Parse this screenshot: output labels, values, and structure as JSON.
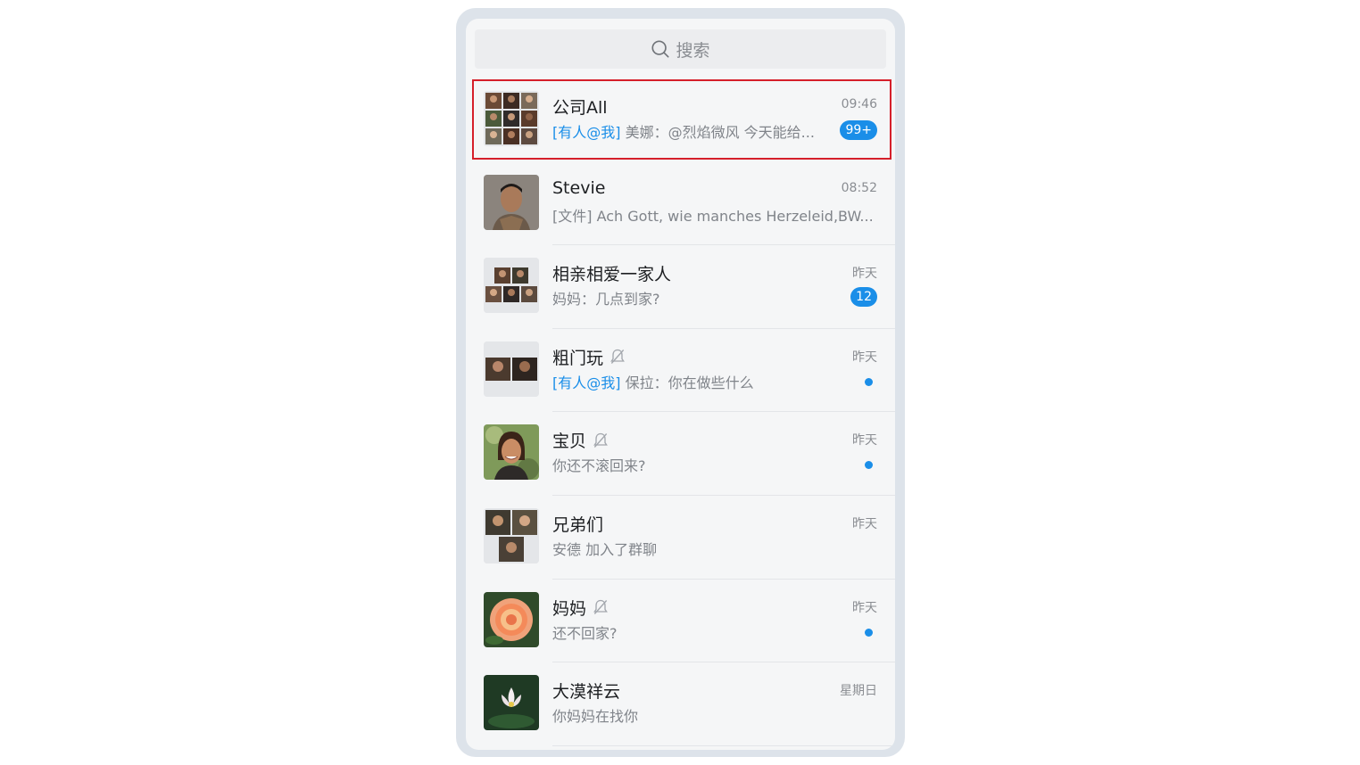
{
  "search": {
    "placeholder_label": "搜索"
  },
  "chats": [
    {
      "name": "公司All",
      "time": "09:46",
      "mention": "[有人@我]",
      "preview": "美娜：@烈焰微风 今天能给...",
      "badge": "99+",
      "muted": false,
      "dot": false,
      "avatar": "group-9"
    },
    {
      "name": "Stevie",
      "time": "08:52",
      "mention": "",
      "preview": "[文件] Ach Gott, wie manches Herzeleid,BW...",
      "badge": "",
      "muted": false,
      "dot": false,
      "avatar": "person-man"
    },
    {
      "name": "相亲相爱一家人",
      "time": "昨天",
      "mention": "",
      "preview": "妈妈：几点到家?",
      "badge": "12",
      "muted": false,
      "dot": false,
      "avatar": "group-6"
    },
    {
      "name": "粗门玩",
      "time": "昨天",
      "mention": "[有人@我]",
      "preview": "保拉：你在做些什么",
      "badge": "",
      "muted": true,
      "dot": true,
      "avatar": "group-2"
    },
    {
      "name": "宝贝",
      "time": "昨天",
      "mention": "",
      "preview": "你还不滚回来?",
      "badge": "",
      "muted": true,
      "dot": true,
      "avatar": "person-woman"
    },
    {
      "name": "兄弟们",
      "time": "昨天",
      "mention": "",
      "preview": "安德 加入了群聊",
      "badge": "",
      "muted": false,
      "dot": false,
      "avatar": "group-3"
    },
    {
      "name": "妈妈",
      "time": "昨天",
      "mention": "",
      "preview": "还不回家?",
      "badge": "",
      "muted": true,
      "dot": true,
      "avatar": "rose-flower"
    },
    {
      "name": "大漠祥云",
      "time": "星期日",
      "mention": "",
      "preview": "你妈妈在找你",
      "badge": "",
      "muted": false,
      "dot": false,
      "avatar": "lotus-flower"
    }
  ],
  "colors": {
    "accent": "#1a8ee8",
    "highlight": "#d51f2a"
  }
}
